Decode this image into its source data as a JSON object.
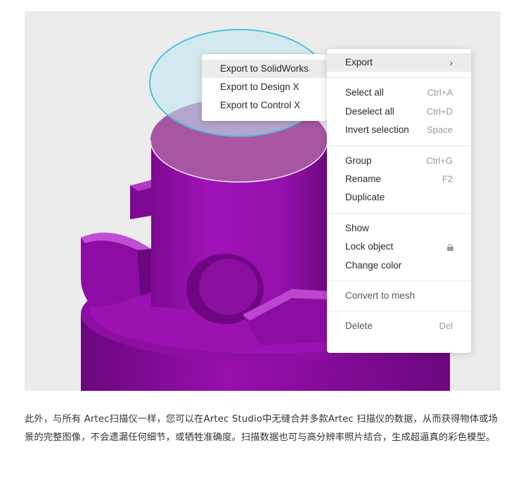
{
  "colors": {
    "object_purple": "#9a0fb0",
    "object_top": "#a856a3",
    "selection_cyan": "#bde8f0",
    "menu_bg": "#ffffff",
    "scene_bg": "#ececed"
  },
  "export_submenu": {
    "items": [
      {
        "label": "Export to SolidWorks"
      },
      {
        "label": "Export to Design X"
      },
      {
        "label": "Export to Control X"
      }
    ]
  },
  "context_menu": {
    "export": {
      "label": "Export",
      "icon": "chevron-right-icon",
      "glyph": "›"
    },
    "select_all": {
      "label": "Select all",
      "shortcut": "Ctrl+A"
    },
    "deselect_all": {
      "label": "Deselect all",
      "shortcut": "Ctrl+D"
    },
    "invert_selection": {
      "label": "Invert selection",
      "shortcut": "Space"
    },
    "group": {
      "label": "Group",
      "shortcut": "Ctrl+G"
    },
    "rename": {
      "label": "Rename",
      "shortcut": "F2"
    },
    "duplicate": {
      "label": "Duplicate"
    },
    "show": {
      "label": "Show"
    },
    "lock_object": {
      "label": "Lock object",
      "icon": "lock-icon"
    },
    "change_color": {
      "label": "Change color"
    },
    "convert_to_mesh": {
      "label": "Convert to mesh"
    },
    "delete": {
      "label": "Delete",
      "shortcut": "Del"
    }
  },
  "caption": "此外，与所有 Artec扫描仪一样，您可以在Artec Studio中无缝合并多款Artec 扫描仪的数据，从而获得物体或场景的完整图像，不会遗漏任何细节，或牺牲准确度。扫描数据也可与高分辨率照片结合，生成超逼真的彩色模型。"
}
